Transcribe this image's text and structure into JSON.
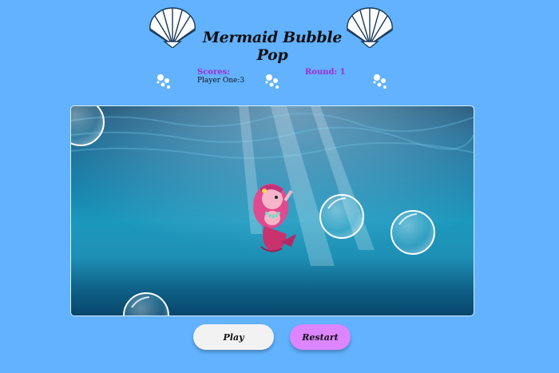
{
  "header": {
    "title": "Mermaid Bubble Pop"
  },
  "scoreboard": {
    "scores_label": "Scores:",
    "player_score": "Player One:3",
    "round_label": "Round: 1"
  },
  "controls": {
    "play_label": "Play",
    "restart_label": "Restart"
  },
  "icons": {
    "shells": [
      "seashell-icon",
      "seashell-icon"
    ],
    "decorative_bubbles": [
      "bubbles-icon",
      "bubbles-icon",
      "bubbles-icon"
    ]
  },
  "colors": {
    "background": "#62b2ff",
    "score_label": "#a12ad6",
    "restart_button": "#dd85ff",
    "play_button": "#f2f2f2"
  }
}
